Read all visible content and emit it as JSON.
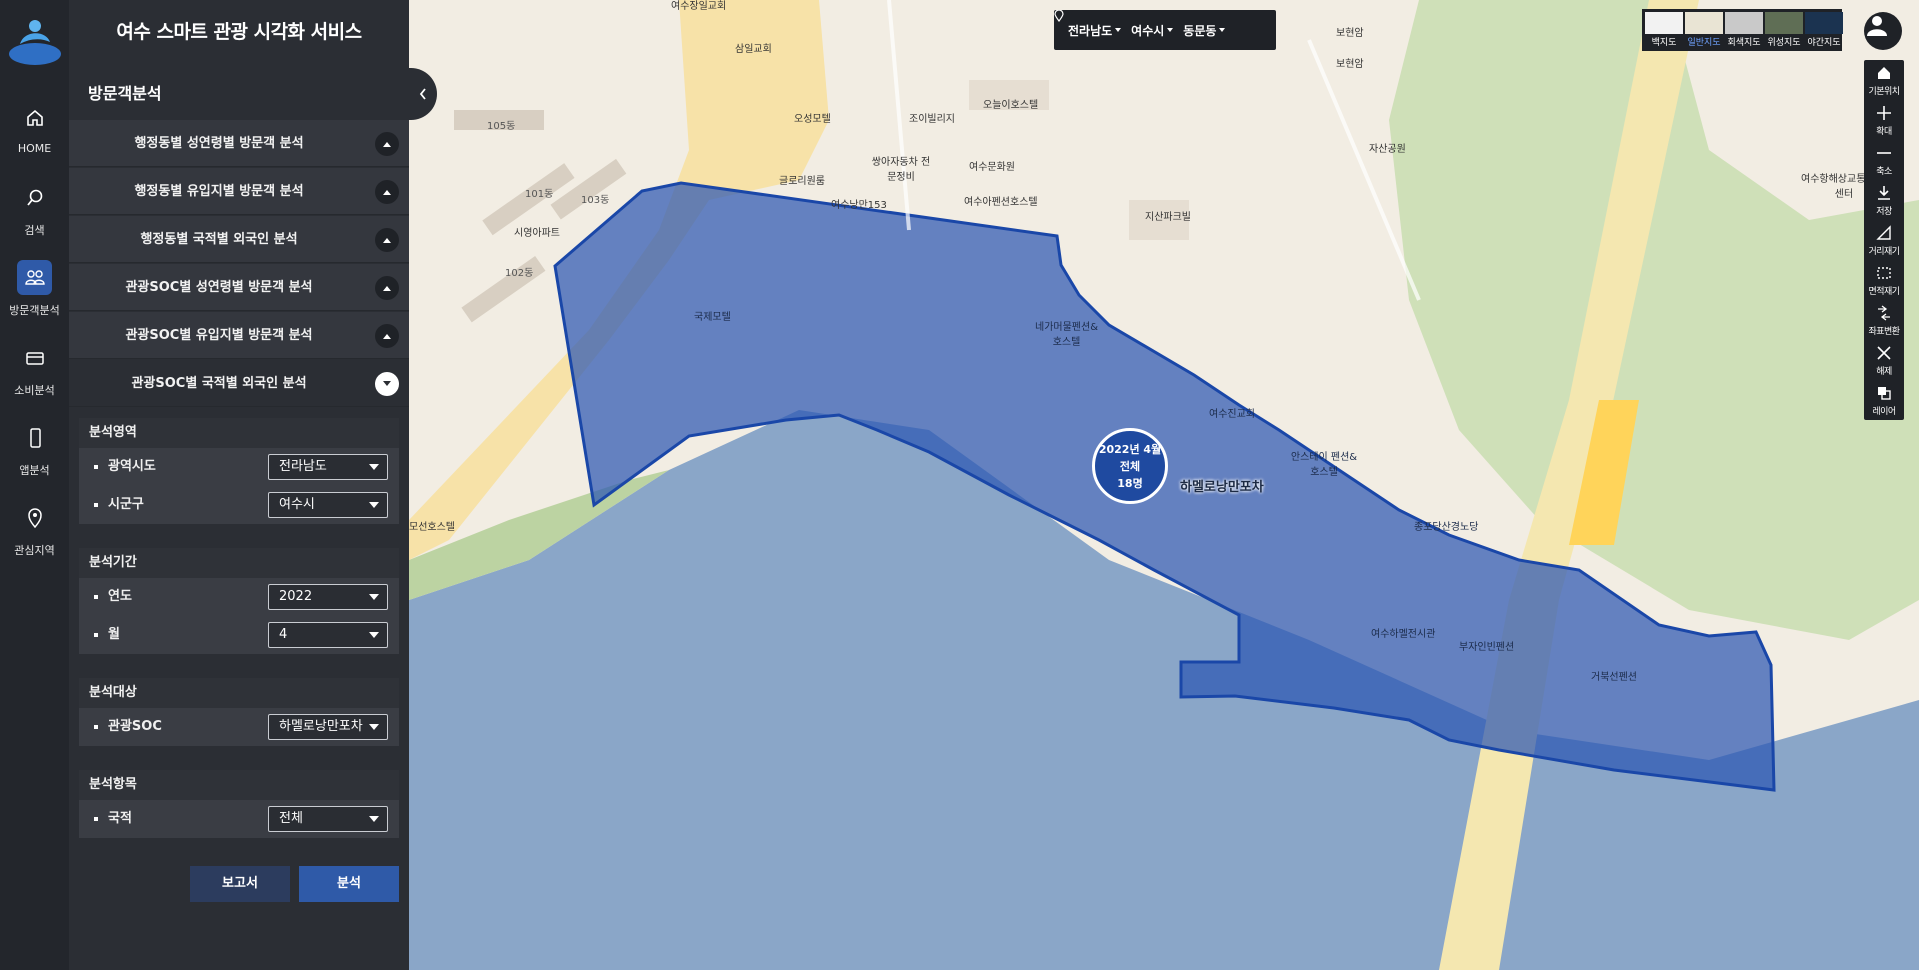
{
  "app_title": "여수 스마트 관광 시각화 서비스",
  "rail": [
    {
      "label": "HOME",
      "icon": "home-icon"
    },
    {
      "label": "검색",
      "icon": "search-icon"
    },
    {
      "label": "방문객분석",
      "icon": "people-icon",
      "active": true
    },
    {
      "label": "소비분석",
      "icon": "card-icon"
    },
    {
      "label": "앱분석",
      "icon": "phone-icon"
    },
    {
      "label": "관심지역",
      "icon": "location-pin-icon"
    }
  ],
  "section_title": "방문객분석",
  "accordion": [
    {
      "label": "행정동별 성연령별 방문객 분석"
    },
    {
      "label": "행정동별 유입지별 방문객 분석"
    },
    {
      "label": "행정동별 국적별 외국인 분석"
    },
    {
      "label": "관광SOC별 성연령별 방문객 분석"
    },
    {
      "label": "관광SOC별 유입지별 방문객 분석"
    },
    {
      "label": "관광SOC별 국적별 외국인 분석",
      "open": true
    }
  ],
  "form": {
    "area": {
      "title": "분석영역",
      "province_label": "광역시도",
      "province_value": "전라남도",
      "city_label": "시군구",
      "city_value": "여수시"
    },
    "period": {
      "title": "분석기간",
      "year_label": "연도",
      "year_value": "2022",
      "month_label": "월",
      "month_value": "4"
    },
    "target": {
      "title": "분석대상",
      "soc_label": "관광SOC",
      "soc_value": "하멜로낭만포차"
    },
    "item": {
      "title": "분석항목",
      "nation_label": "국적",
      "nation_value": "전체"
    }
  },
  "buttons": {
    "report": "보고서",
    "analyze": "분석"
  },
  "region_bar": {
    "province": "전라남도",
    "city": "여수시",
    "dong": "동문동"
  },
  "map_types": [
    {
      "label": "백지도"
    },
    {
      "label": "일반지도",
      "active": true
    },
    {
      "label": "회색지도"
    },
    {
      "label": "위성지도"
    },
    {
      "label": "야간지도"
    }
  ],
  "tools": [
    "기본위치",
    "확대",
    "축소",
    "저장",
    "거리재기",
    "면적재기",
    "좌표변환",
    "해제",
    "레이어"
  ],
  "marker": {
    "line1": "2022년 4월",
    "line2": "전체",
    "line3": "18명",
    "label": "하멜로낭만포차"
  },
  "map_labels": [
    "여수장일교회",
    "삼일교회",
    "보현암",
    "보현암",
    "105동",
    "오성모텔",
    "조이빌리지",
    "오늘이호스텔",
    "101동",
    "103동",
    "글로리원룸",
    "쌍아자동차 전문정비",
    "여수문화원",
    "자산공원",
    "시영아파트",
    "102동",
    "여수낭만153",
    "여수아펜션호스텔",
    "지산파크빌",
    "여수항해상교통 관제센터",
    "국제모텔",
    "네가머물펜션& 호스텔",
    "여수진교회",
    "안스테이 펜션&호스텔",
    "모선호스텔",
    "여수하멜전시관",
    "부자인빈펜션",
    "거북선펜션",
    "종포당산경노당"
  ],
  "colors": {
    "accent": "#2f5aa8",
    "polygon_fill": "#2d57b3",
    "sea": "#8aa6c8",
    "land": "#f2ede3"
  }
}
